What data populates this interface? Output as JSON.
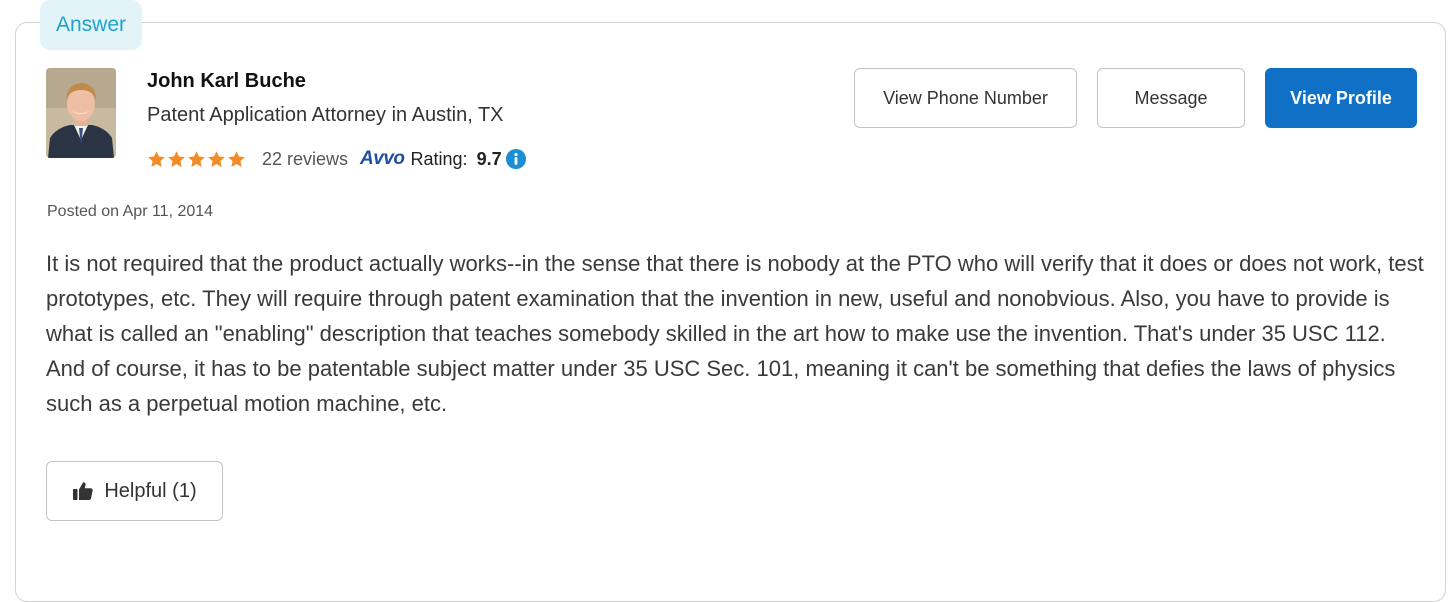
{
  "answer_tag": "Answer",
  "attorney": {
    "name": "John Karl Buche",
    "title": "Patent Application Attorney in Austin, TX",
    "star_rating": 5,
    "reviews": "22 reviews",
    "avvo_logo": "Avvo",
    "rating_label": "Rating:",
    "rating_value": "9.7"
  },
  "actions": {
    "phone_label": "View Phone Number",
    "message_label": "Message",
    "profile_label": "View Profile"
  },
  "posted": "Posted on Apr 11, 2014",
  "answer_text": "It is not required that the product actually works--in the sense that there is nobody at the PTO who will verify that it does or does not work, test prototypes, etc. They will require through patent examination that the invention in new, useful and nonobvious. Also, you have to provide is what is called an \"enabling\" description that teaches somebody skilled in the art how to make use the invention. That's under 35 USC 112. And of course, it has to be patentable subject matter under 35 USC Sec. 101, meaning it can't be something that defies the laws of physics such as a perpetual motion machine, etc.",
  "helpful_label": "Helpful (1)",
  "colors": {
    "star": "#f28c28",
    "primary_button": "#0f70c5",
    "answer_tag_bg": "#e3f4f9",
    "answer_tag_text": "#1ea2c9",
    "avvo_logo": "#1f4fa3",
    "info_icon": "#1a8fd6"
  },
  "icons": {
    "star": "star-icon",
    "info": "info-icon",
    "helpful": "thumbs-up-icon"
  }
}
